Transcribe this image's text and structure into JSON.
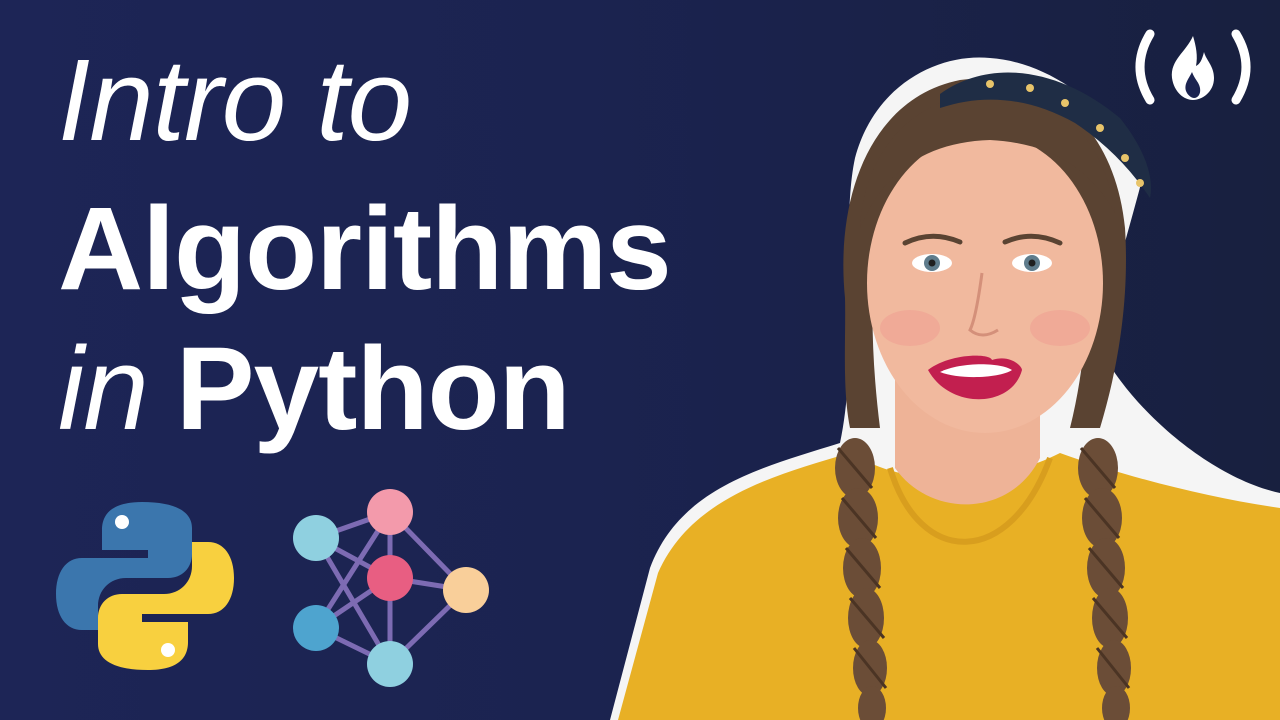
{
  "title": {
    "line1": "Intro to",
    "line2": "Algorithms",
    "line3_lead": "in",
    "line3_word": "Python"
  },
  "colors": {
    "background": "#1b2350",
    "title_text": "#ffffff",
    "python_blue": "#3b76ad",
    "python_yellow": "#f8d03f",
    "node_light_blue": "#8fd0e0",
    "node_blue": "#4ea4cf",
    "node_pink": "#f28b9f",
    "node_peach": "#f9cf9a",
    "edge_purple": "#7d6bb3",
    "shirt": "#e8b025"
  },
  "icons": {
    "brand": "freecodecamp-logo-icon",
    "language": "python-logo-icon",
    "graph": "graph-network-icon"
  }
}
